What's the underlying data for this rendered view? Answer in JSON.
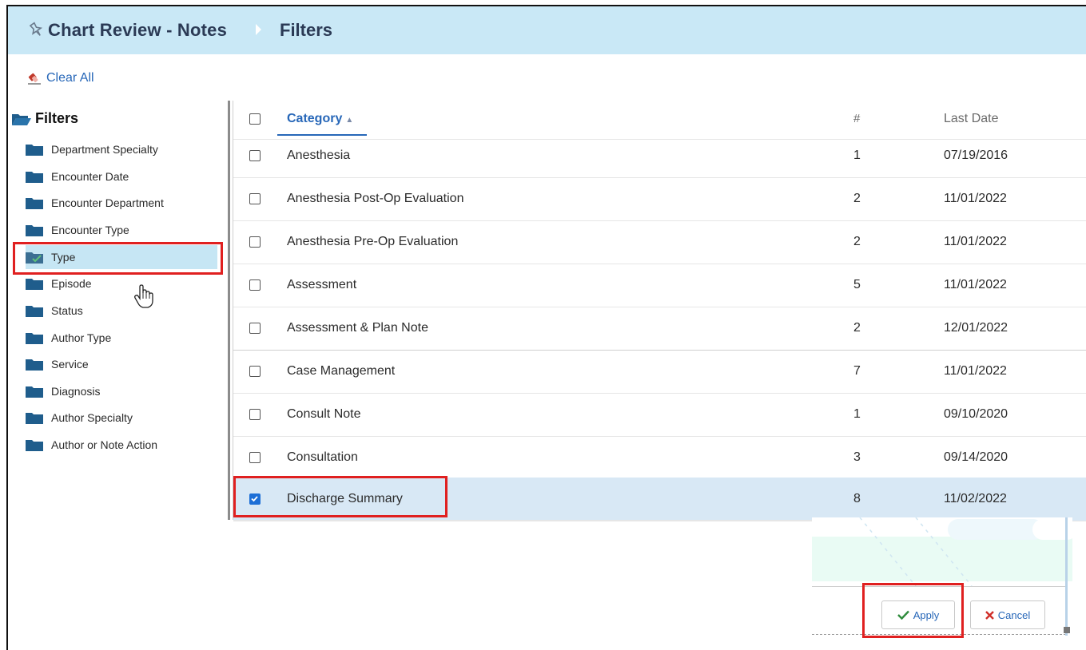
{
  "header": {
    "breadcrumb": [
      "Chart Review - Notes",
      "Filters"
    ]
  },
  "toolbar": {
    "clear_all_label": "Clear All"
  },
  "sidebar": {
    "title": "Filters",
    "items": [
      {
        "label": "Department Specialty"
      },
      {
        "label": "Encounter Date"
      },
      {
        "label": "Encounter Department"
      },
      {
        "label": "Encounter Type"
      },
      {
        "label": "Type",
        "selected": true
      },
      {
        "label": "Episode"
      },
      {
        "label": "Status"
      },
      {
        "label": "Author Type"
      },
      {
        "label": "Service"
      },
      {
        "label": "Diagnosis"
      },
      {
        "label": "Author Specialty"
      },
      {
        "label": "Author or Note Action"
      }
    ]
  },
  "table": {
    "columns": {
      "category": "Category",
      "count": "#",
      "last_date": "Last Date"
    },
    "sort_indicator": "▲",
    "rows": [
      {
        "category": "Anesthesia",
        "count": "1",
        "last_date": "07/19/2016",
        "checked": false
      },
      {
        "category": "Anesthesia Post-Op Evaluation",
        "count": "2",
        "last_date": "11/01/2022",
        "checked": false
      },
      {
        "category": "Anesthesia Pre-Op Evaluation",
        "count": "2",
        "last_date": "11/01/2022",
        "checked": false
      },
      {
        "category": "Assessment",
        "count": "5",
        "last_date": "11/01/2022",
        "checked": false
      },
      {
        "category": "Assessment & Plan Note",
        "count": "2",
        "last_date": "12/01/2022",
        "checked": false
      },
      {
        "category": "Case Management",
        "count": "7",
        "last_date": "11/01/2022",
        "checked": false
      },
      {
        "category": "Consult Note",
        "count": "1",
        "last_date": "09/10/2020",
        "checked": false
      },
      {
        "category": "Consultation",
        "count": "3",
        "last_date": "09/14/2020",
        "checked": false
      },
      {
        "category": "Discharge Summary",
        "count": "8",
        "last_date": "11/02/2022",
        "checked": true
      }
    ]
  },
  "actions": {
    "apply_label": "Apply",
    "cancel_label": "Cancel"
  },
  "colors": {
    "title_bar": "#c9e8f6",
    "accent": "#2767b8",
    "highlight": "#e02020",
    "selected_row": "#d8e8f5",
    "folder": "#1f5d8c"
  },
  "icons": {
    "title": "pin-icon",
    "clear_all": "eraser-icon",
    "sidebar_title": "open-folder-icon",
    "sidebar_item": "folder-icon",
    "apply": "checkmark-icon",
    "cancel": "x-icon"
  }
}
